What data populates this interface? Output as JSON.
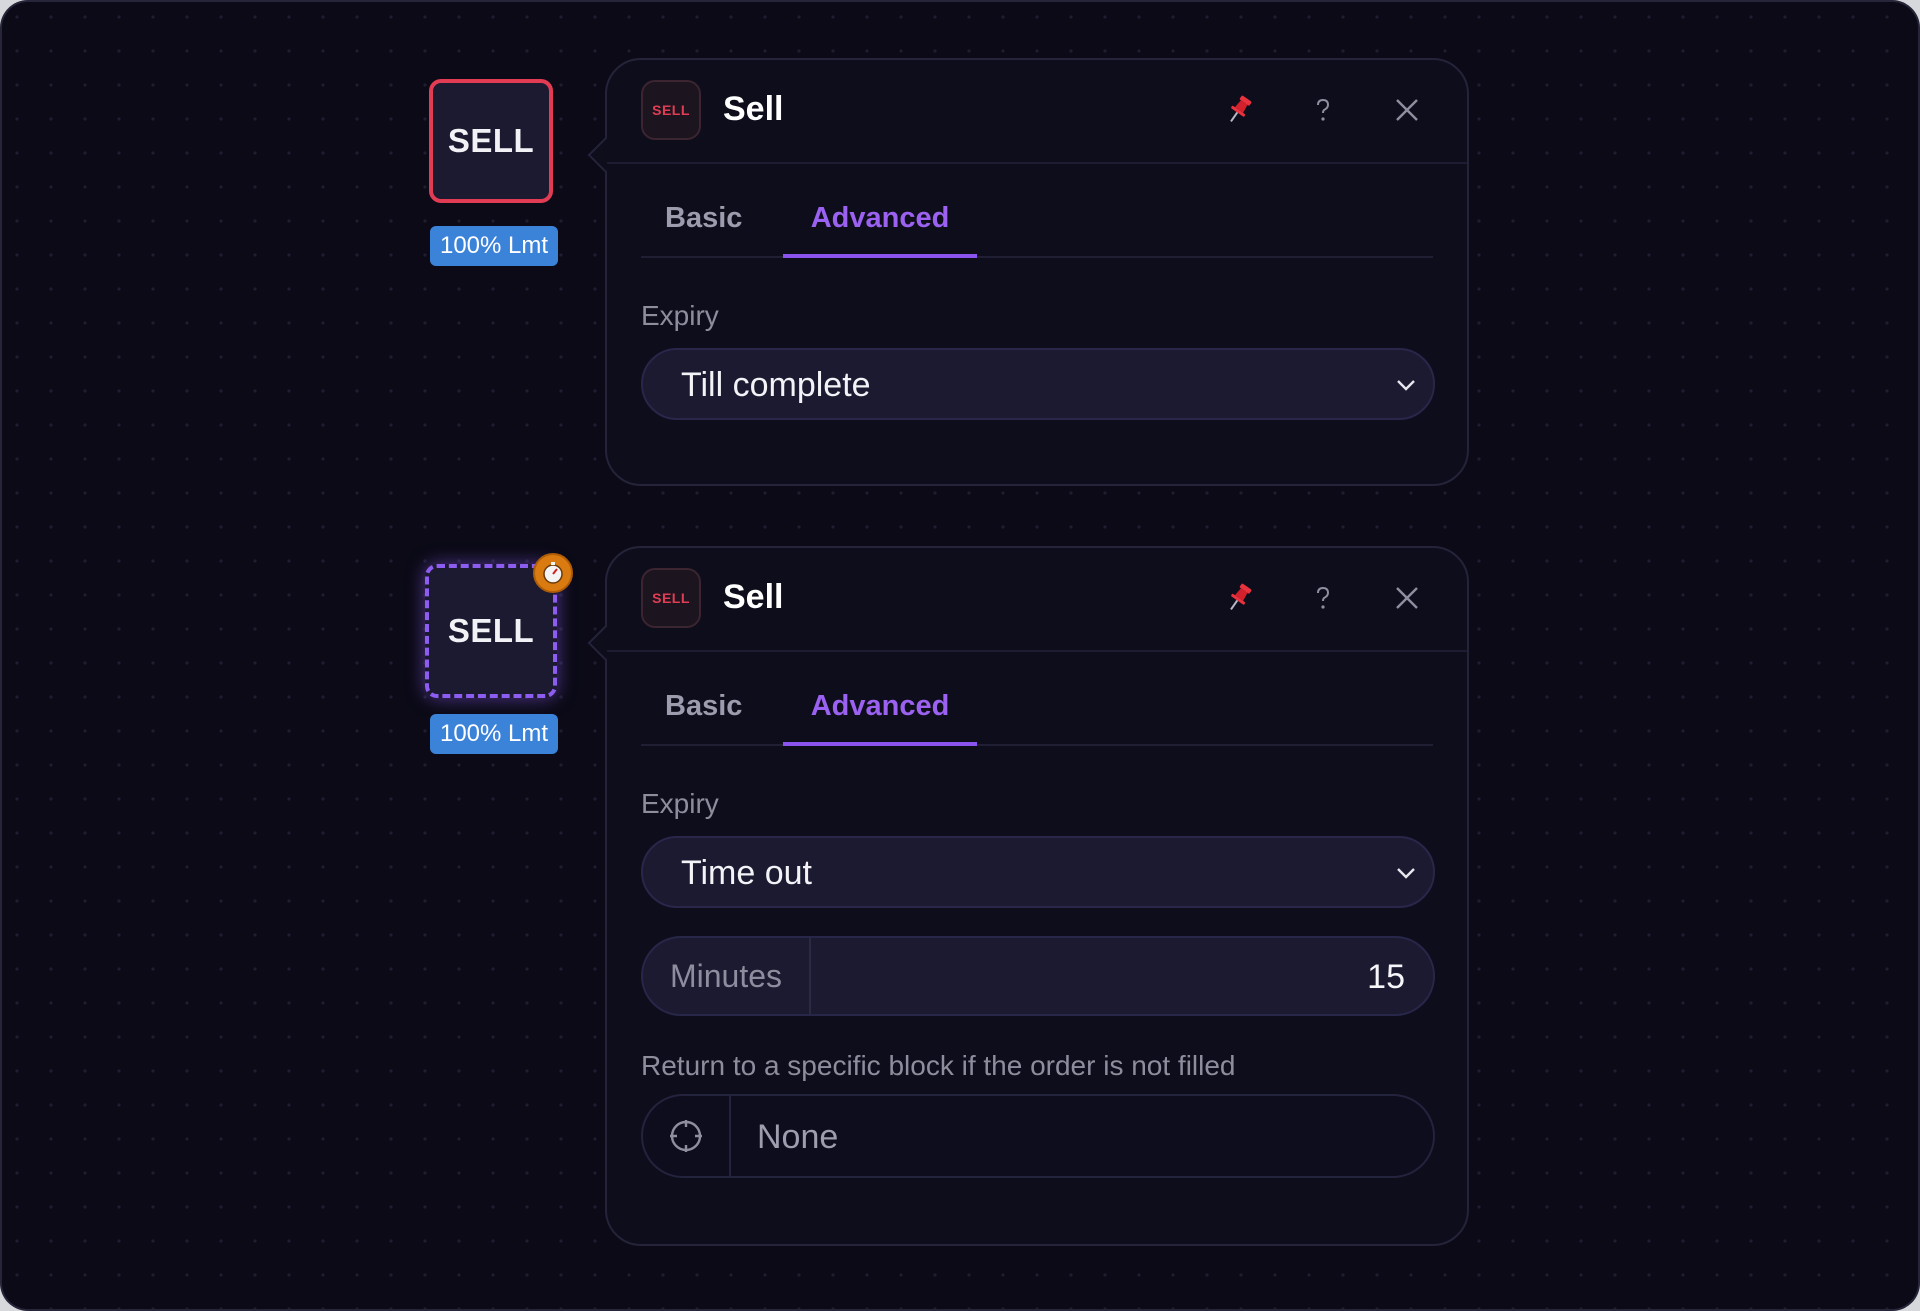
{
  "nodes": [
    {
      "label": "SELL",
      "badge": "100% Lmt",
      "state": "selected-red"
    },
    {
      "label": "SELL",
      "badge": "100% Lmt",
      "state": "dashed-purple",
      "timer_icon": "stopwatch-icon"
    }
  ],
  "panels": [
    {
      "icon_text": "SELL",
      "title": "Sell",
      "tabs": {
        "basic": "Basic",
        "advanced": "Advanced",
        "active": "Advanced"
      },
      "expiry_label": "Expiry",
      "expiry_value": "Till complete"
    },
    {
      "icon_text": "SELL",
      "title": "Sell",
      "tabs": {
        "basic": "Basic",
        "advanced": "Advanced",
        "active": "Advanced"
      },
      "expiry_label": "Expiry",
      "expiry_value": "Time out",
      "minutes_label": "Minutes",
      "minutes_value": "15",
      "return_label": "Return to a specific block if the order is not filled",
      "return_value": "None"
    }
  ],
  "icons": {
    "pin": "pin-icon",
    "help": "help-icon",
    "close": "close-icon",
    "chevron": "chevron-down-icon",
    "target": "crosshair-icon"
  },
  "colors": {
    "accent": "#8a55ee",
    "sell_red": "#e23c55",
    "badge_blue": "#3b82d9",
    "timer_orange": "#d97b10"
  }
}
